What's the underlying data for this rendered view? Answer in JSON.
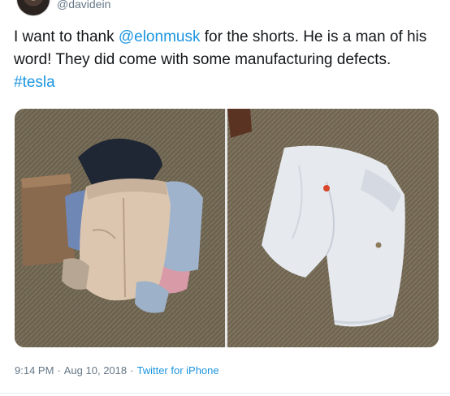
{
  "author": {
    "handle": "@davidein"
  },
  "tweet": {
    "text_before_mention": "I want to thank ",
    "mention": "@elonmusk",
    "text_after_mention": " for the shorts. He is a man of his word!  They did come with some manufacturing defects. ",
    "hashtag": "#tesla"
  },
  "media": {
    "count": 2,
    "photos": [
      {
        "subject": "pile of clothes with shorts on a carpet"
      },
      {
        "subject": "white shorts laid flat on a carpet"
      }
    ]
  },
  "footer": {
    "time": "9:14 PM",
    "separator": "·",
    "date": "Aug 10, 2018",
    "source": "Twitter for iPhone"
  },
  "colors": {
    "link": "#1b95e0",
    "text": "#14171a",
    "meta": "#657786",
    "carpet": "#6f6552",
    "shorts": "#e6e9ee"
  },
  "icons": {
    "avatar": "profile-photo"
  }
}
